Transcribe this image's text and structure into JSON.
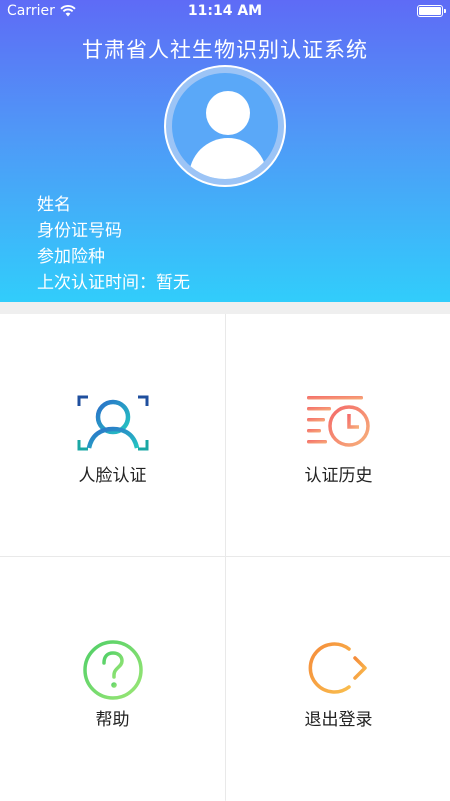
{
  "status_bar": {
    "carrier": "Carrier",
    "time": "11:14 AM"
  },
  "header": {
    "title": "甘肃省人社生物识别认证系统",
    "name_label": "姓名",
    "id_label": "身份证号码",
    "insurance_label": "参加险种",
    "last_auth_label": "上次认证时间：",
    "last_auth_value": "暂无"
  },
  "menu": {
    "face_auth": {
      "label": "人脸认证",
      "icon": "face-scan-icon",
      "color": "#1f9ad6"
    },
    "history": {
      "label": "认证历史",
      "icon": "history-clock-icon",
      "color": "#f47b63"
    },
    "help": {
      "label": "帮助",
      "icon": "question-mark-icon",
      "color": "#6fd86b"
    },
    "logout": {
      "label": "退出登录",
      "icon": "logout-arrow-icon",
      "color": "#f7a23a"
    }
  }
}
